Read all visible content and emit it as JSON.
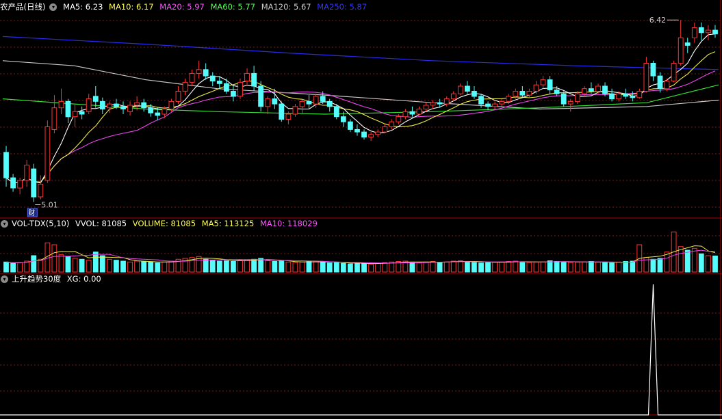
{
  "header_main": {
    "title": "农产品(日线)",
    "items": [
      {
        "label": "MA5: 6.23",
        "color": "#ffffff"
      },
      {
        "label": "MA10: 6.17",
        "color": "#ffff55"
      },
      {
        "label": "MA20: 5.97",
        "color": "#ff55ff"
      },
      {
        "label": "MA60: 5.77",
        "color": "#55ff55"
      },
      {
        "label": "MA120: 5.67",
        "color": "#cccccc"
      },
      {
        "label": "MA250: 5.87",
        "color": "#3333ff"
      }
    ]
  },
  "header_vol": {
    "title": "VOL-TDX(5,10)",
    "items": [
      {
        "label": "VVOL: 81085",
        "color": "#ffffff"
      },
      {
        "label": "VOLUME: 81085",
        "color": "#ffff55"
      },
      {
        "label": "MA5: 113125",
        "color": "#ffff55"
      },
      {
        "label": "MA10: 118029",
        "color": "#ff55ff"
      }
    ]
  },
  "header_xg": {
    "title": "上升趋势30度",
    "items": [
      {
        "label": "XG: 0.00",
        "color": "#ffffff"
      }
    ]
  },
  "annotations": {
    "high_label": "6.42",
    "low_label": "5.01",
    "fin_marker": "财"
  },
  "colors": {
    "up": "#ff3333",
    "down": "#54fcfc",
    "grid": "#7a1a1a",
    "frame": "#b00000"
  },
  "chart_data": {
    "type": "candlestick",
    "title": "农产品(日线)",
    "ylim": [
      4.9,
      6.5
    ],
    "ohlc": [
      [
        5.4,
        5.45,
        5.13,
        5.2
      ],
      [
        5.2,
        5.23,
        5.09,
        5.12
      ],
      [
        5.12,
        5.2,
        5.07,
        5.18
      ],
      [
        5.18,
        5.34,
        5.13,
        5.3
      ],
      [
        5.27,
        5.31,
        5.01,
        5.05
      ],
      [
        5.05,
        5.22,
        5.03,
        5.15
      ],
      [
        5.18,
        5.65,
        5.16,
        5.6
      ],
      [
        5.58,
        5.85,
        5.55,
        5.75
      ],
      [
        5.75,
        5.9,
        5.7,
        5.8
      ],
      [
        5.8,
        5.82,
        5.63,
        5.68
      ],
      [
        5.68,
        5.78,
        5.6,
        5.72
      ],
      [
        5.72,
        5.76,
        5.66,
        5.7
      ],
      [
        5.72,
        5.86,
        5.7,
        5.82
      ],
      [
        5.84,
        5.92,
        5.75,
        5.8
      ],
      [
        5.8,
        5.83,
        5.7,
        5.74
      ],
      [
        5.75,
        5.8,
        5.71,
        5.78
      ],
      [
        5.78,
        5.82,
        5.74,
        5.76
      ],
      [
        5.76,
        5.8,
        5.7,
        5.74
      ],
      [
        5.72,
        5.8,
        5.69,
        5.77
      ],
      [
        5.77,
        5.84,
        5.73,
        5.79
      ],
      [
        5.79,
        5.82,
        5.72,
        5.75
      ],
      [
        5.75,
        5.78,
        5.68,
        5.71
      ],
      [
        5.71,
        5.75,
        5.65,
        5.69
      ],
      [
        5.7,
        5.76,
        5.67,
        5.74
      ],
      [
        5.74,
        5.82,
        5.72,
        5.8
      ],
      [
        5.8,
        5.92,
        5.78,
        5.88
      ],
      [
        5.88,
        5.98,
        5.85,
        5.95
      ],
      [
        5.95,
        6.05,
        5.92,
        6.02
      ],
      [
        6.02,
        6.12,
        5.98,
        6.05
      ],
      [
        6.05,
        6.1,
        5.97,
        6.0
      ],
      [
        6.0,
        6.03,
        5.92,
        5.96
      ],
      [
        5.96,
        6.0,
        5.9,
        5.94
      ],
      [
        5.94,
        5.98,
        5.86,
        5.88
      ],
      [
        5.88,
        5.92,
        5.8,
        5.84
      ],
      [
        5.84,
        5.98,
        5.82,
        5.95
      ],
      [
        5.96,
        6.06,
        5.92,
        6.02
      ],
      [
        6.02,
        6.08,
        5.88,
        5.92
      ],
      [
        5.92,
        5.96,
        5.72,
        5.76
      ],
      [
        5.76,
        5.84,
        5.7,
        5.82
      ],
      [
        5.82,
        5.9,
        5.74,
        5.78
      ],
      [
        5.78,
        5.8,
        5.64,
        5.66
      ],
      [
        5.66,
        5.72,
        5.62,
        5.7
      ],
      [
        5.7,
        5.78,
        5.68,
        5.76
      ],
      [
        5.76,
        5.82,
        5.7,
        5.8
      ],
      [
        5.8,
        5.85,
        5.74,
        5.78
      ],
      [
        5.78,
        5.86,
        5.75,
        5.84
      ],
      [
        5.84,
        5.88,
        5.78,
        5.8
      ],
      [
        5.8,
        5.82,
        5.72,
        5.76
      ],
      [
        5.76,
        5.78,
        5.66,
        5.68
      ],
      [
        5.68,
        5.72,
        5.6,
        5.64
      ],
      [
        5.64,
        5.66,
        5.56,
        5.58
      ],
      [
        5.58,
        5.62,
        5.53,
        5.56
      ],
      [
        5.56,
        5.58,
        5.5,
        5.52
      ],
      [
        5.52,
        5.56,
        5.49,
        5.54
      ],
      [
        5.54,
        5.58,
        5.52,
        5.56
      ],
      [
        5.56,
        5.62,
        5.55,
        5.6
      ],
      [
        5.6,
        5.66,
        5.58,
        5.64
      ],
      [
        5.64,
        5.7,
        5.62,
        5.68
      ],
      [
        5.68,
        5.74,
        5.66,
        5.72
      ],
      [
        5.72,
        5.76,
        5.68,
        5.7
      ],
      [
        5.7,
        5.76,
        5.69,
        5.74
      ],
      [
        5.74,
        5.79,
        5.72,
        5.77
      ],
      [
        5.77,
        5.81,
        5.74,
        5.79
      ],
      [
        5.79,
        5.82,
        5.75,
        5.78
      ],
      [
        5.78,
        5.84,
        5.76,
        5.82
      ],
      [
        5.82,
        5.88,
        5.8,
        5.86
      ],
      [
        5.86,
        5.94,
        5.85,
        5.92
      ],
      [
        5.92,
        5.96,
        5.86,
        5.88
      ],
      [
        5.88,
        5.92,
        5.82,
        5.84
      ],
      [
        5.84,
        5.86,
        5.75,
        5.78
      ],
      [
        5.78,
        5.8,
        5.73,
        5.76
      ],
      [
        5.76,
        5.8,
        5.74,
        5.78
      ],
      [
        5.78,
        5.82,
        5.76,
        5.8
      ],
      [
        5.8,
        5.86,
        5.78,
        5.84
      ],
      [
        5.84,
        5.9,
        5.82,
        5.88
      ],
      [
        5.88,
        5.92,
        5.83,
        5.85
      ],
      [
        5.85,
        5.9,
        5.83,
        5.88
      ],
      [
        5.88,
        5.96,
        5.86,
        5.93
      ],
      [
        5.93,
        6.0,
        5.9,
        5.97
      ],
      [
        5.97,
        6.0,
        5.86,
        5.89
      ],
      [
        5.89,
        5.92,
        5.84,
        5.86
      ],
      [
        5.86,
        5.88,
        5.76,
        5.78
      ],
      [
        5.78,
        5.82,
        5.72,
        5.8
      ],
      [
        5.8,
        5.88,
        5.78,
        5.86
      ],
      [
        5.86,
        5.92,
        5.84,
        5.9
      ],
      [
        5.9,
        5.95,
        5.86,
        5.88
      ],
      [
        5.88,
        5.94,
        5.86,
        5.92
      ],
      [
        5.92,
        5.95,
        5.84,
        5.86
      ],
      [
        5.86,
        5.9,
        5.8,
        5.82
      ],
      [
        5.82,
        5.88,
        5.8,
        5.86
      ],
      [
        5.86,
        5.9,
        5.82,
        5.84
      ],
      [
        5.84,
        5.88,
        5.8,
        5.83
      ],
      [
        5.83,
        5.9,
        5.82,
        5.88
      ],
      [
        5.88,
        6.15,
        5.87,
        6.1
      ],
      [
        6.1,
        6.12,
        5.96,
        6.0
      ],
      [
        6.0,
        6.03,
        5.87,
        5.9
      ],
      [
        5.9,
        5.98,
        5.88,
        5.96
      ],
      [
        5.96,
        6.12,
        5.95,
        6.1
      ],
      [
        6.1,
        6.44,
        6.08,
        6.3
      ],
      [
        6.26,
        6.3,
        6.18,
        6.24
      ],
      [
        6.3,
        6.42,
        6.26,
        6.38
      ],
      [
        6.38,
        6.42,
        6.28,
        6.34
      ],
      [
        6.34,
        6.4,
        6.28,
        6.36
      ],
      [
        6.36,
        6.4,
        6.3,
        6.33
      ]
    ],
    "ma_lines": [
      {
        "name": "MA5",
        "value": 6.23
      },
      {
        "name": "MA10",
        "value": 6.17
      },
      {
        "name": "MA20",
        "value": 5.97
      },
      {
        "name": "MA60",
        "value": 5.77
      },
      {
        "name": "MA120",
        "value": 5.67
      },
      {
        "name": "MA250",
        "value": 5.87
      }
    ],
    "ma250_path": [
      [
        0,
        6.31
      ],
      [
        20,
        6.25
      ],
      [
        40,
        6.18
      ],
      [
        60,
        6.12
      ],
      [
        80,
        6.08
      ],
      [
        100,
        6.05
      ]
    ],
    "ma120_path": [
      [
        0,
        6.12
      ],
      [
        10,
        6.08
      ],
      [
        20,
        5.97
      ],
      [
        30,
        5.9
      ],
      [
        45,
        5.85
      ],
      [
        60,
        5.79
      ],
      [
        75,
        5.74
      ],
      [
        90,
        5.76
      ],
      [
        100,
        5.81
      ]
    ],
    "ma60_path": [
      [
        0,
        5.82
      ],
      [
        10,
        5.78
      ],
      [
        20,
        5.74
      ],
      [
        30,
        5.72
      ],
      [
        45,
        5.7
      ],
      [
        60,
        5.72
      ],
      [
        75,
        5.75
      ],
      [
        90,
        5.79
      ],
      [
        100,
        5.93
      ]
    ],
    "volume": [
      55,
      48,
      52,
      60,
      90,
      70,
      160,
      150,
      95,
      85,
      75,
      70,
      65,
      110,
      90,
      70,
      65,
      60,
      55,
      60,
      58,
      55,
      50,
      55,
      60,
      70,
      75,
      80,
      85,
      70,
      65,
      60,
      62,
      58,
      64,
      68,
      70,
      75,
      62,
      58,
      60,
      55,
      52,
      55,
      58,
      60,
      55,
      50,
      52,
      48,
      45,
      50,
      46,
      44,
      48,
      52,
      55,
      58,
      60,
      52,
      50,
      55,
      58,
      54,
      56,
      60,
      62,
      58,
      55,
      50,
      52,
      54,
      56,
      58,
      60,
      55,
      52,
      54,
      56,
      62,
      58,
      55,
      52,
      54,
      56,
      58,
      54,
      52,
      50,
      55,
      58,
      60,
      150,
      80,
      70,
      75,
      110,
      220,
      140,
      120,
      130,
      100,
      90,
      88
    ],
    "volume_ylim": [
      0,
      240
    ],
    "xg": {
      "spike_index": 94,
      "value": 1.0,
      "ylim": [
        0,
        1.0
      ]
    }
  }
}
